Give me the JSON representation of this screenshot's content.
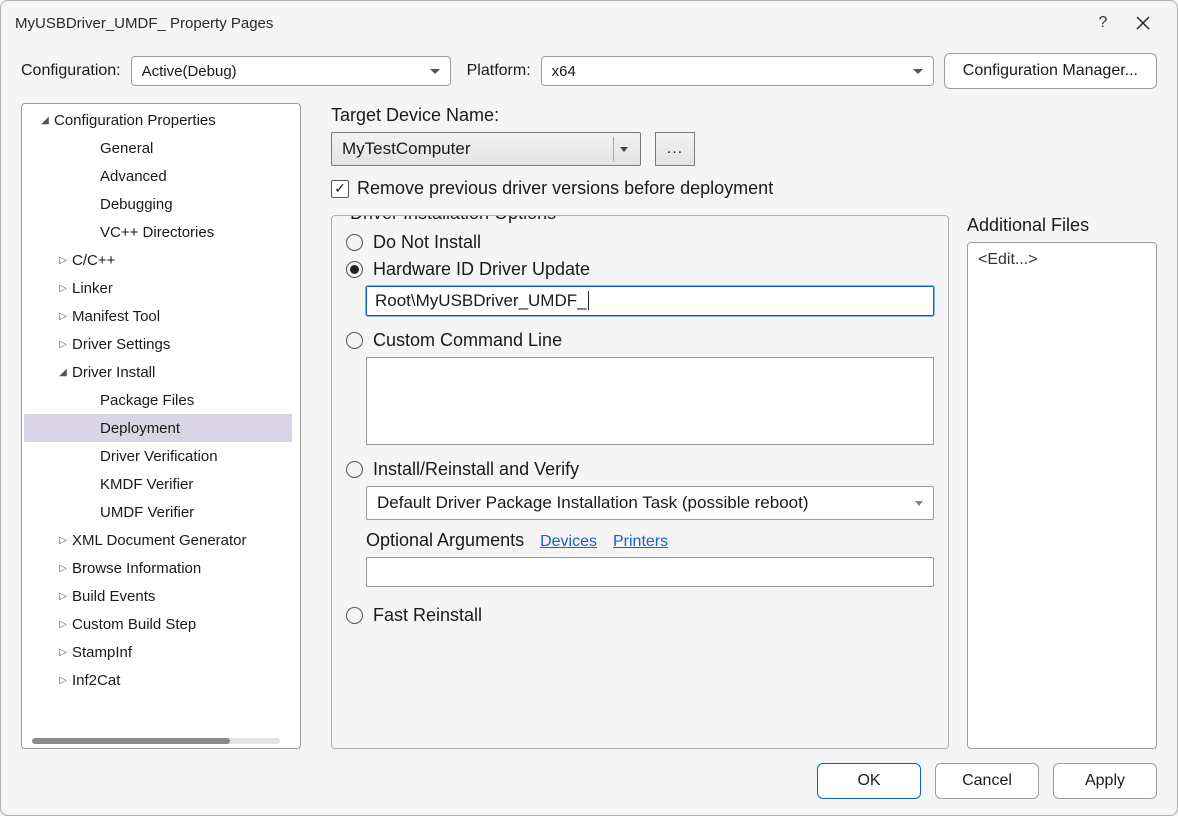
{
  "window": {
    "title": "MyUSBDriver_UMDF_ Property Pages"
  },
  "toprow": {
    "configuration_label": "Configuration:",
    "configuration_value": "Active(Debug)",
    "platform_label": "Platform:",
    "platform_value": "x64",
    "cfgmgr_label": "Configuration Manager..."
  },
  "tree": [
    {
      "label": "Configuration Properties",
      "indent": 1,
      "arrow": "down"
    },
    {
      "label": "General",
      "indent": 3
    },
    {
      "label": "Advanced",
      "indent": 3
    },
    {
      "label": "Debugging",
      "indent": 3
    },
    {
      "label": "VC++ Directories",
      "indent": 3
    },
    {
      "label": "C/C++",
      "indent": 2,
      "arrow": "right"
    },
    {
      "label": "Linker",
      "indent": 2,
      "arrow": "right"
    },
    {
      "label": "Manifest Tool",
      "indent": 2,
      "arrow": "right"
    },
    {
      "label": "Driver Settings",
      "indent": 2,
      "arrow": "right"
    },
    {
      "label": "Driver Install",
      "indent": 2,
      "arrow": "down"
    },
    {
      "label": "Package Files",
      "indent": 3
    },
    {
      "label": "Deployment",
      "indent": 3,
      "selected": true
    },
    {
      "label": "Driver Verification",
      "indent": 3
    },
    {
      "label": "KMDF Verifier",
      "indent": 3
    },
    {
      "label": "UMDF Verifier",
      "indent": 3
    },
    {
      "label": "XML Document Generator",
      "indent": 2,
      "arrow": "right"
    },
    {
      "label": "Browse Information",
      "indent": 2,
      "arrow": "right"
    },
    {
      "label": "Build Events",
      "indent": 2,
      "arrow": "right"
    },
    {
      "label": "Custom Build Step",
      "indent": 2,
      "arrow": "right"
    },
    {
      "label": "StampInf",
      "indent": 2,
      "arrow": "right"
    },
    {
      "label": "Inf2Cat",
      "indent": 2,
      "arrow": "right"
    }
  ],
  "main": {
    "target_label": "Target Device Name:",
    "target_value": "MyTestComputer",
    "browse_label": "...",
    "remove_prev_label": "Remove previous driver versions before deployment",
    "remove_prev_checked": true,
    "group_label": "Driver Installation Options",
    "radios": {
      "donot_label": "Do Not Install",
      "hwid_label": "Hardware ID Driver Update",
      "hwid_value": "Root\\MyUSBDriver_UMDF_",
      "custom_label": "Custom Command Line",
      "custom_value": "",
      "install_label": "Install/Reinstall and Verify",
      "install_combo": "Default Driver Package Installation Task (possible reboot)",
      "optarg_label": "Optional Arguments",
      "optarg_link_devices": "Devices",
      "optarg_link_printers": "Printers",
      "optarg_value": "",
      "fast_label": "Fast Reinstall"
    },
    "addfiles_label": "Additional Files",
    "addfiles_value": "<Edit...>"
  },
  "footer": {
    "ok": "OK",
    "cancel": "Cancel",
    "apply": "Apply"
  }
}
